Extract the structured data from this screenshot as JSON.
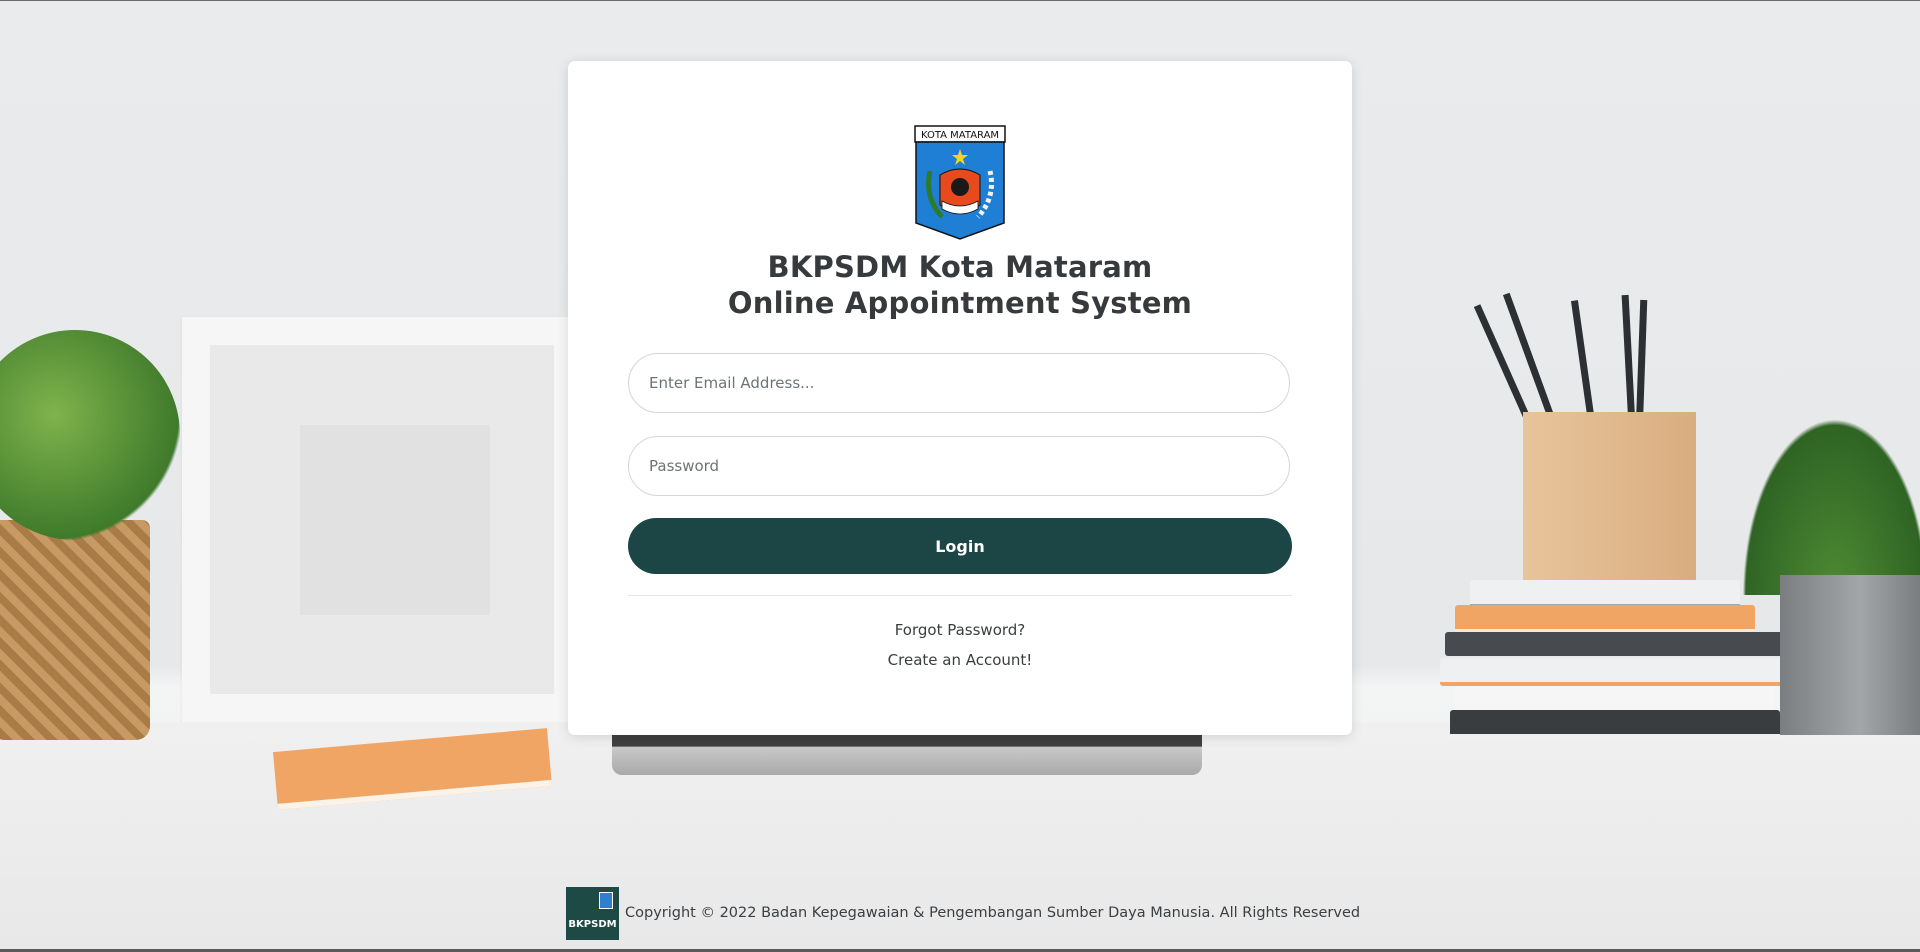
{
  "logo": {
    "banner_text": "KOTA MATARAM",
    "icon": "kota-mataram-emblem-icon"
  },
  "title": {
    "line1": "BKPSDM Kota Mataram",
    "line2": "Online Appointment System"
  },
  "form": {
    "email_placeholder": "Enter Email Address...",
    "email_value": "",
    "password_placeholder": "Password",
    "password_value": "",
    "login_label": "Login"
  },
  "links": {
    "forgot": "Forgot Password?",
    "create": "Create an Account!"
  },
  "footer": {
    "logo_text": "BKPSDM",
    "copyright": "Copyright © 2022 Badan Kepegawaian & Pengembangan Sumber Daya Manusia. All Rights Reserved"
  },
  "colors": {
    "primary": "#1b4645",
    "card": "#ffffff",
    "text": "#373a3d"
  }
}
